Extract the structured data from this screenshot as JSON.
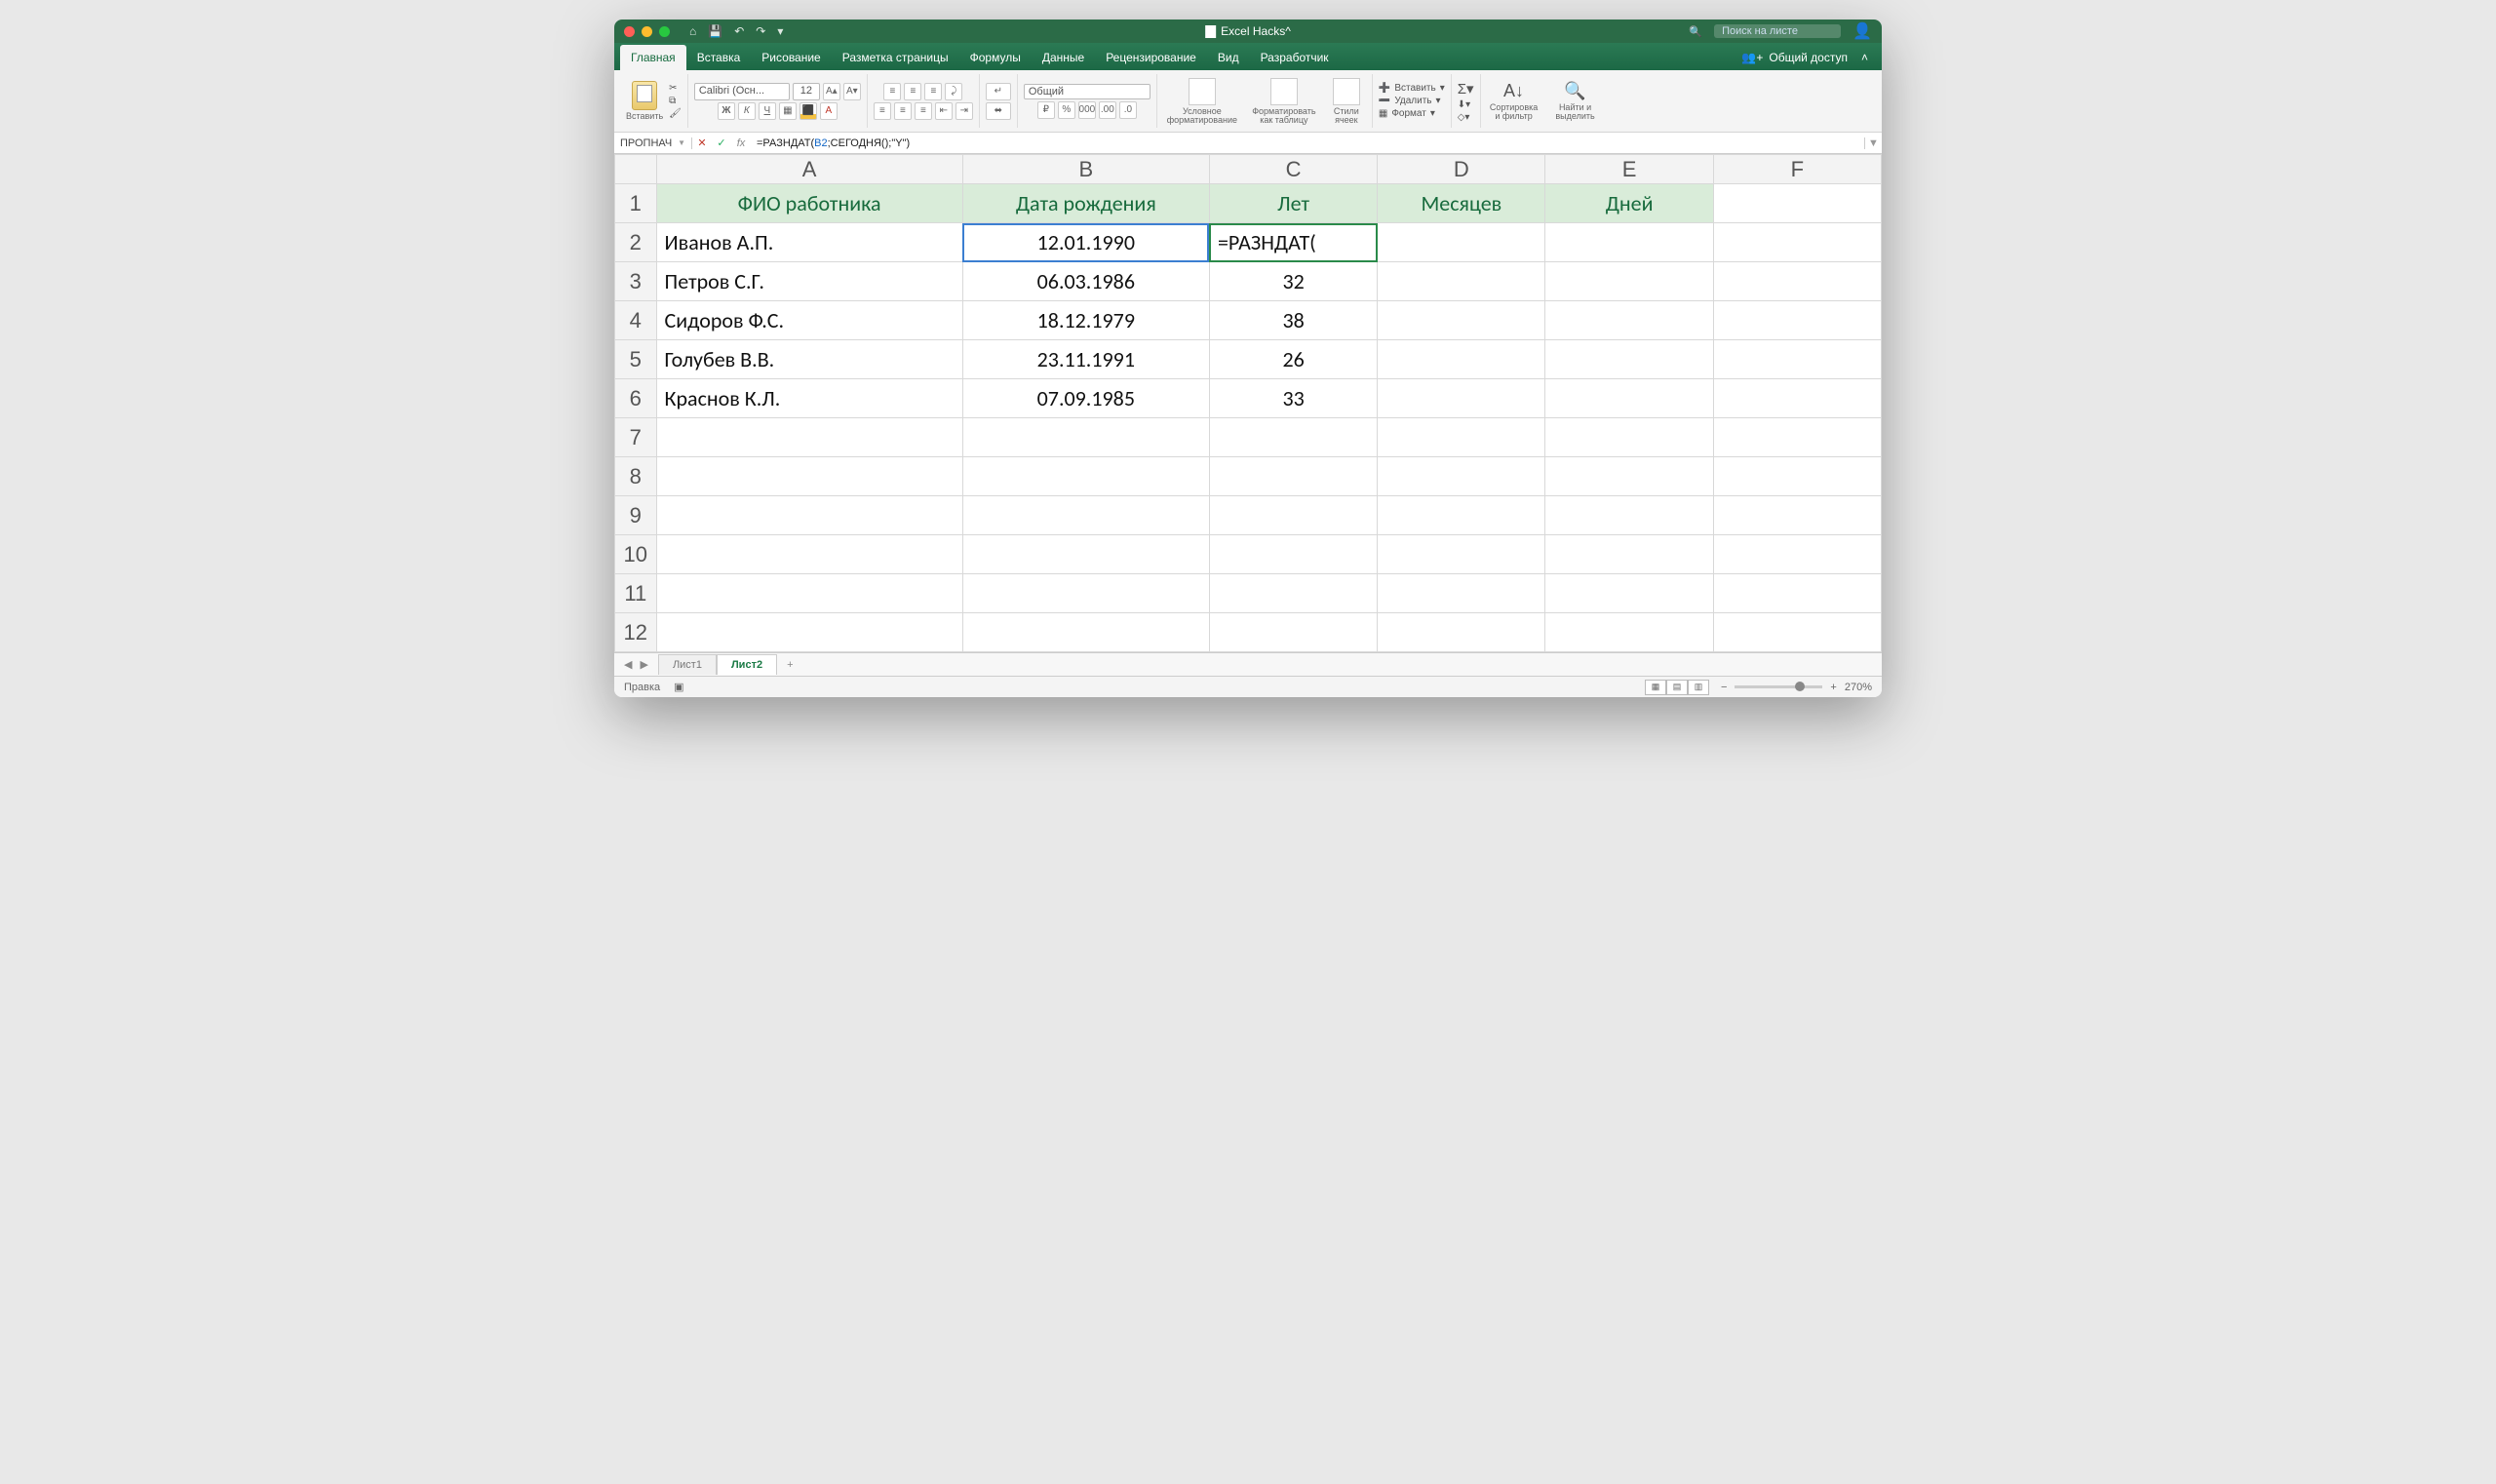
{
  "title": "Excel Hacks^",
  "search_placeholder": "Поиск на листе",
  "share_label": "Общий доступ",
  "tabs": [
    "Главная",
    "Вставка",
    "Рисование",
    "Разметка страницы",
    "Формулы",
    "Данные",
    "Рецензирование",
    "Вид",
    "Разработчик"
  ],
  "active_tab": "Главная",
  "ribbon": {
    "paste": "Вставить",
    "font_name": "Calibri (Осн...",
    "font_size": "12",
    "number_fmt": "Общий",
    "cond_fmt": "Условное форматирование",
    "fmt_table": "Форматировать как таблицу",
    "cell_styles": "Стили ячеек",
    "insert": "Вставить",
    "delete": "Удалить",
    "format": "Формат",
    "sort": "Сортировка и фильтр",
    "find": "Найти и выделить"
  },
  "namebox": "ПРОПНАЧ",
  "formula": {
    "pre": "=РАЗНДАТ(",
    "ref": "B2",
    "mid": ";СЕГОДНЯ();\"Y\")"
  },
  "cols": [
    "A",
    "B",
    "C",
    "D",
    "E",
    "F"
  ],
  "header_row": [
    "ФИО работника",
    "Дата рождения",
    "Лет",
    "Месяцев",
    "Дней"
  ],
  "rows": [
    {
      "a": "Иванов А.П.",
      "b": "12.01.1990",
      "c": "=РАЗНДАТ("
    },
    {
      "a": "Петров С.Г.",
      "b": "06.03.1986",
      "c": "32"
    },
    {
      "a": "Сидоров Ф.С.",
      "b": "18.12.1979",
      "c": "38"
    },
    {
      "a": "Голубев В.В.",
      "b": "23.11.1991",
      "c": "26"
    },
    {
      "a": "Краснов К.Л.",
      "b": "07.09.1985",
      "c": "33"
    }
  ],
  "visible_rows": 12,
  "sheets": [
    "Лист1",
    "Лист2"
  ],
  "active_sheet": "Лист2",
  "status": "Правка",
  "zoom": "270%"
}
